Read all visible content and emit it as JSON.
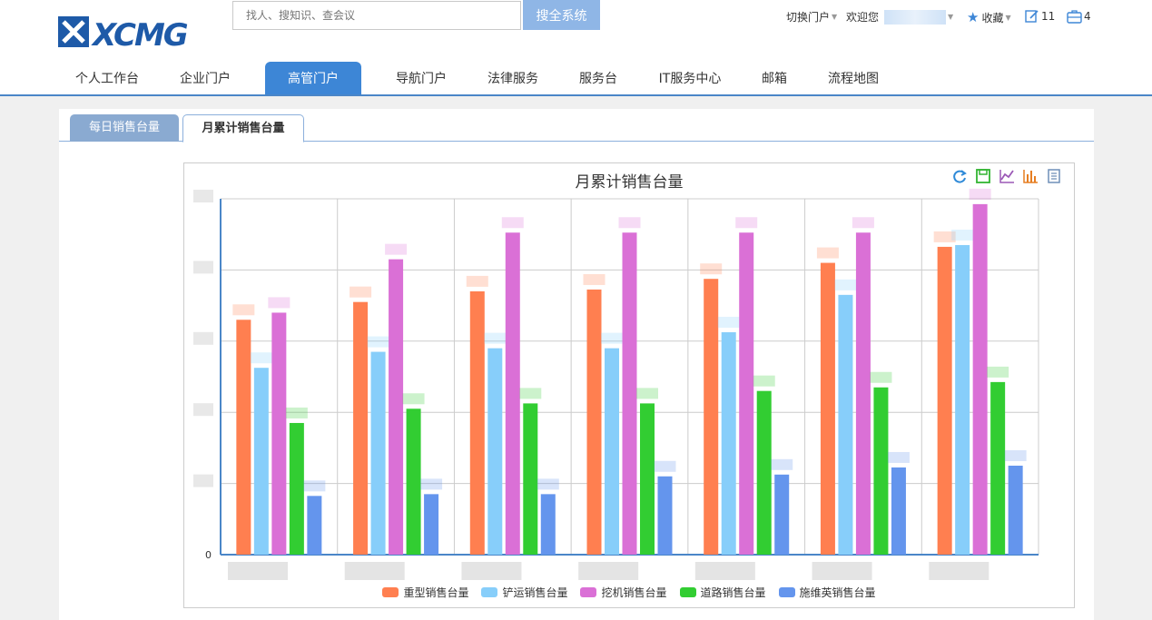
{
  "brand": {
    "logo_text": "XCMG",
    "logo_color": "#1e5aa8"
  },
  "search": {
    "placeholder": "找人、搜知识、查会议",
    "button_label": "搜全系统"
  },
  "topbar": {
    "switch_portal": "切换门户",
    "welcome": "欢迎您",
    "favorites": "收藏",
    "edit_count": "11",
    "briefcase_count": "4"
  },
  "nav": {
    "items": [
      "个人工作台",
      "企业门户",
      "高管门户",
      "导航门户",
      "法律服务",
      "服务台",
      "IT服务中心",
      "邮箱",
      "流程地图"
    ],
    "active_index": 2
  },
  "tabs": {
    "items": [
      "每日销售台量",
      "月累计销售台量"
    ],
    "active_index": 1
  },
  "chart_data": {
    "type": "bar",
    "title": "月累计销售台量",
    "categories": [
      "",
      "",
      "",
      "",
      "",
      "",
      ""
    ],
    "y_tick_labels": [
      "0"
    ],
    "y_range": [
      0,
      100
    ],
    "grid": true,
    "legend_position": "bottom",
    "series": [
      {
        "name": "重型销售台量",
        "color": "#ff7f50",
        "values": [
          66,
          71,
          74,
          74.5,
          77.5,
          82,
          86.5
        ]
      },
      {
        "name": "铲运销售台量",
        "color": "#87cefa",
        "values": [
          52.5,
          57,
          58,
          58,
          62.5,
          73,
          87
        ]
      },
      {
        "name": "挖机销售台量",
        "color": "#da70d6",
        "values": [
          68,
          83,
          90.5,
          90.5,
          90.5,
          90.5,
          98.5
        ]
      },
      {
        "name": "道路销售台量",
        "color": "#32cd32",
        "values": [
          37,
          41,
          42.5,
          42.5,
          46,
          47,
          48.5
        ]
      },
      {
        "name": "施维英销售台量",
        "color": "#6495ed",
        "values": [
          16.5,
          17,
          17,
          22,
          22.5,
          24.5,
          25
        ]
      }
    ]
  }
}
